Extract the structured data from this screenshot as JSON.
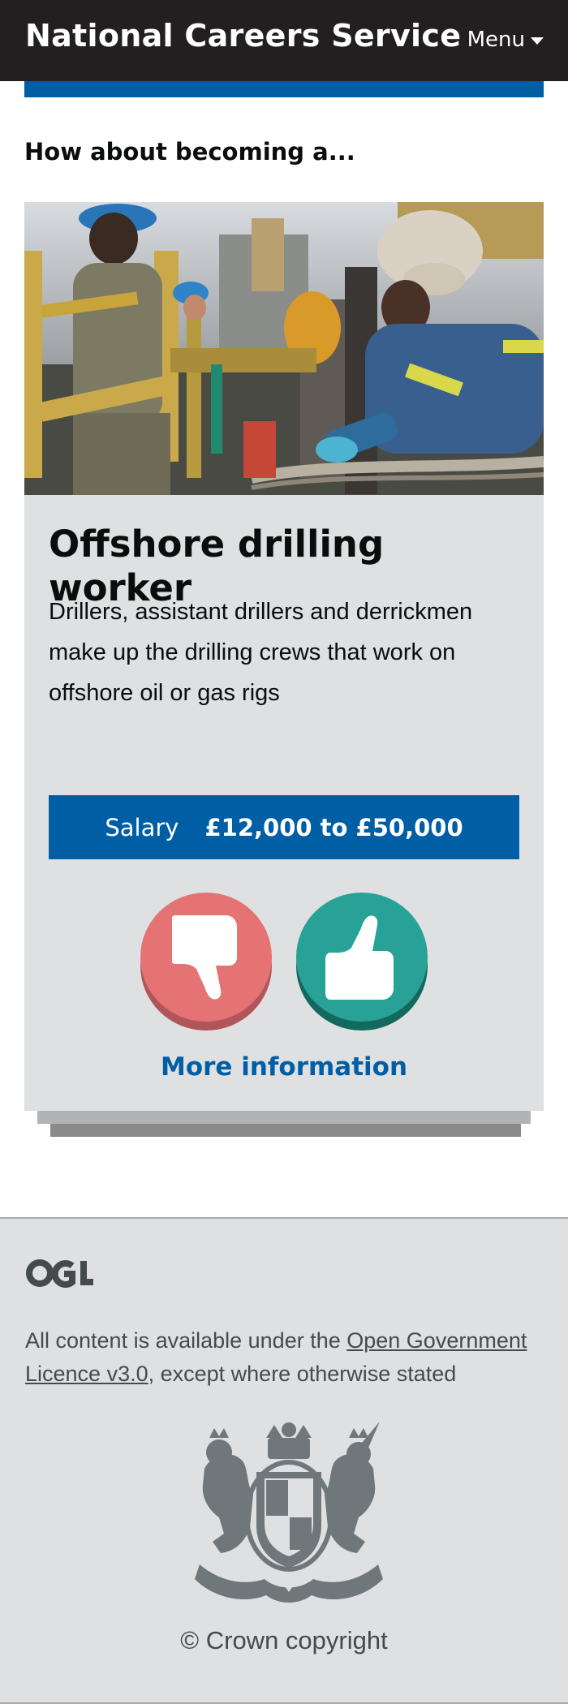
{
  "header": {
    "site_name": "National Careers Service",
    "menu_label": "Menu"
  },
  "intro": "How about becoming a...",
  "card": {
    "title": "Offshore drilling worker",
    "description": "Drillers, assistant drillers and derrickmen make up the drilling crews that work on offshore oil or gas rigs",
    "salary_label": "Salary",
    "salary_value": "£12,000 to £50,000",
    "dislike_icon": "thumbs-down-icon",
    "like_icon": "thumbs-up-icon",
    "more_info": "More information"
  },
  "footer": {
    "logo_text": "OGL",
    "licence_prefix": "All content is available under the ",
    "licence_link": "Open Government Licence v3.0",
    "licence_suffix": ", except where otherwise stated",
    "crest_icon": "royal-coat-of-arms-icon",
    "copyright": "© Crown copyright"
  },
  "colors": {
    "header_bg": "#231f20",
    "brand_blue": "#005ea5",
    "card_bg": "#dee0e2",
    "dislike": "#e57373",
    "like": "#28a197"
  }
}
